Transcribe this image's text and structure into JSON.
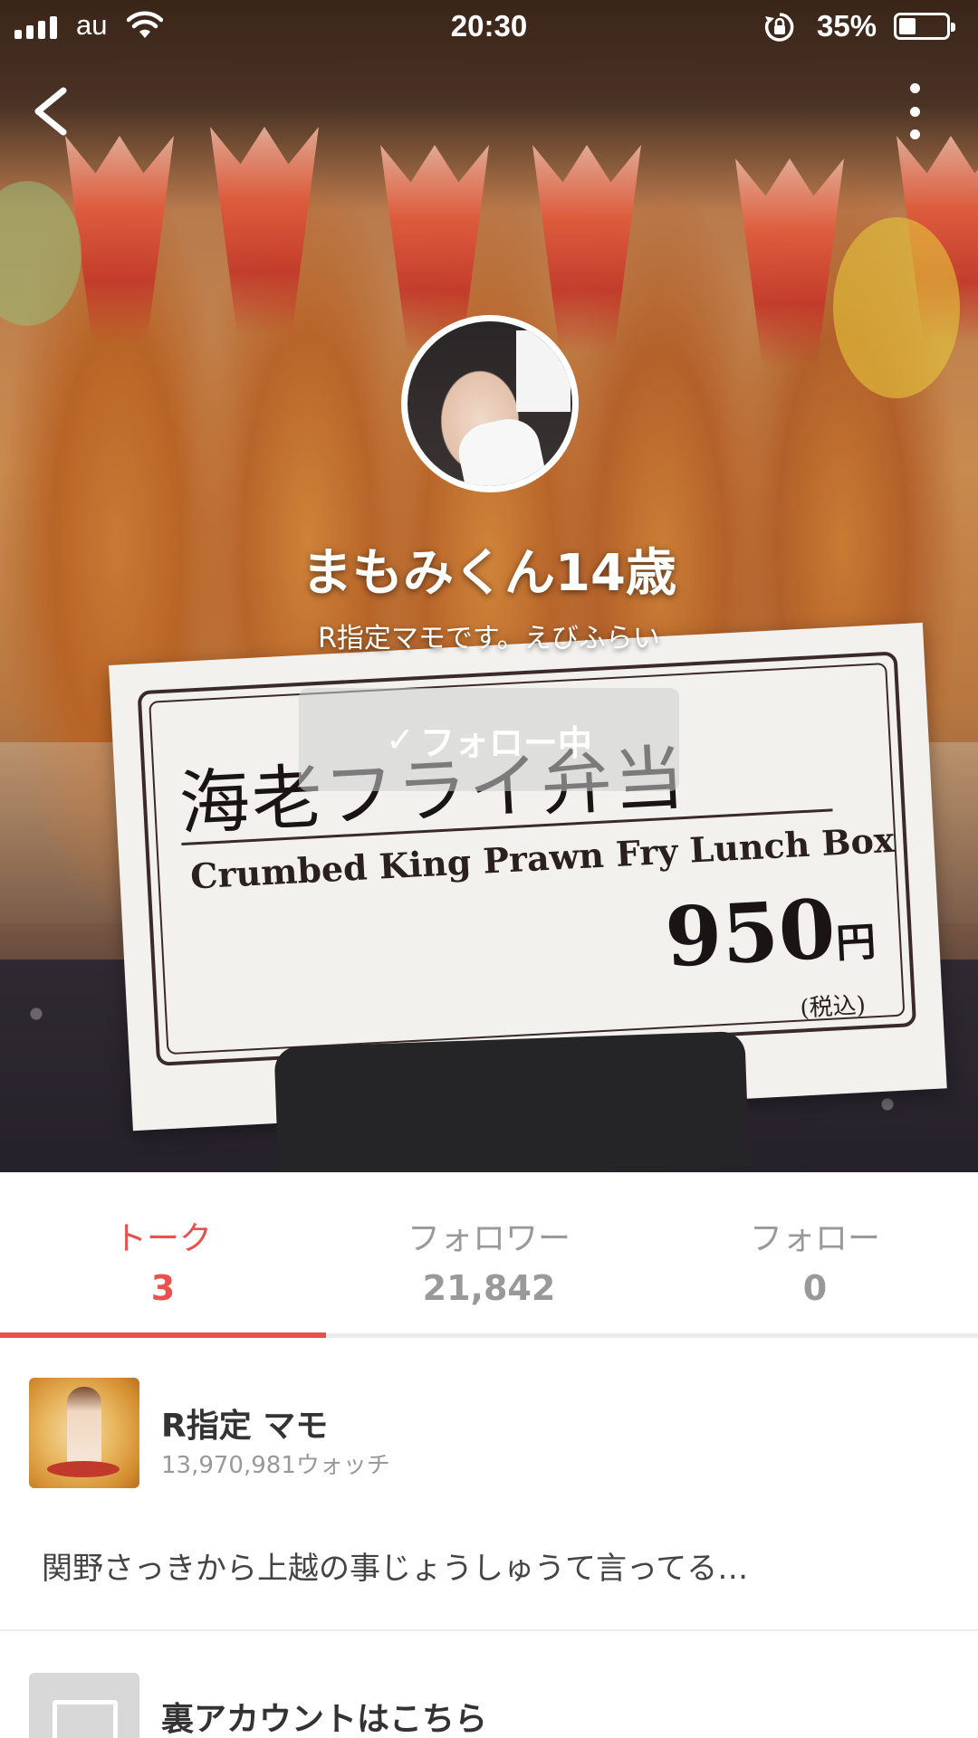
{
  "status_bar": {
    "carrier": "au",
    "time": "20:30",
    "battery_percent": "35%",
    "battery_level": 0.35,
    "icons": [
      "cellular-signal-icon",
      "wifi-icon",
      "rotation-lock-icon",
      "battery-icon"
    ]
  },
  "nav": {
    "back_icon": "chevron-left-icon",
    "more_icon": "vertical-ellipsis-icon"
  },
  "profile": {
    "name": "まもみくん14歳",
    "bio": "R指定マモです。えびふらい",
    "follow_check": "✓",
    "follow_label": "フォロー中"
  },
  "cover_sign": {
    "jp": "海老フライ弁当",
    "en": "Crumbed King Prawn Fry Lunch Box",
    "price": "950",
    "currency": "円",
    "tax_note": "(税込)"
  },
  "tabs": [
    {
      "label": "トーク",
      "count": "3",
      "active": true
    },
    {
      "label": "フォロワー",
      "count": "21,842",
      "active": false
    },
    {
      "label": "フォロー",
      "count": "0",
      "active": false
    }
  ],
  "feed": [
    {
      "title": "R指定 マモ",
      "watch_count": "13,970,981ウォッチ",
      "body": "関野さっきから上越の事じょうしゅうて言ってる…"
    },
    {
      "title": "裏アカウントはこちら"
    }
  ],
  "colors": {
    "accent": "#e8514d",
    "muted_text": "#999999",
    "divider": "#ececec"
  }
}
